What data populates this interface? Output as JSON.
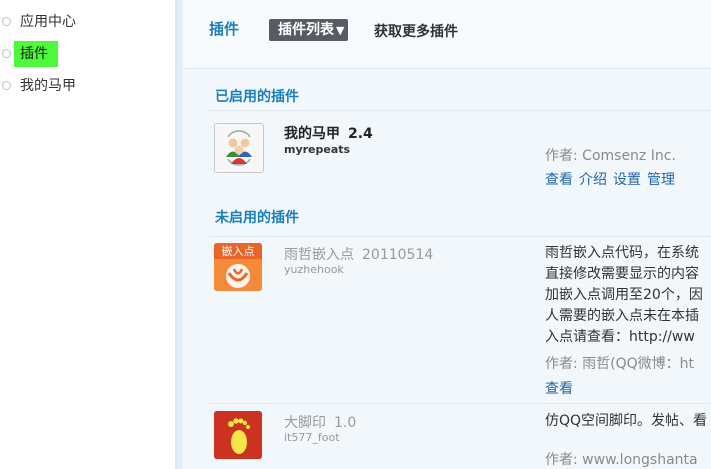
{
  "sidebar": {
    "items": [
      {
        "label": "应用中心",
        "active": false
      },
      {
        "label": "插件",
        "active": true
      },
      {
        "label": "我的马甲",
        "active": false
      }
    ]
  },
  "header": {
    "title": "插件",
    "tab_active": "插件列表",
    "tab_more": "获取更多插件"
  },
  "enabled_section": {
    "title": "已启用的插件",
    "plugins": [
      {
        "name": "我的马甲",
        "version": "2.4",
        "id": "myrepeats",
        "author": "作者: Comsenz Inc.",
        "actions": [
          "查看",
          "介绍",
          "设置",
          "管理"
        ]
      }
    ]
  },
  "disabled_section": {
    "title": "未启用的插件",
    "plugins": [
      {
        "name": "雨哲嵌入点",
        "version": "20110514",
        "id": "yuzhehook",
        "icon_text": "嵌入点",
        "description": [
          "雨哲嵌入点代码，在系统",
          "直接修改需要显示的内容",
          "加嵌入点调用至20个，因",
          "人需要的嵌入点未在本插",
          "入点请查看：http://ww"
        ],
        "author": "作者: 雨哲(QQ微博：ht",
        "actions": [
          "查看"
        ]
      },
      {
        "name": "大脚印",
        "version": "1.0",
        "id": "it577_foot",
        "description": [
          "仿QQ空间脚印。发帖、看"
        ],
        "author": "作者: www.longshanta"
      }
    ]
  }
}
